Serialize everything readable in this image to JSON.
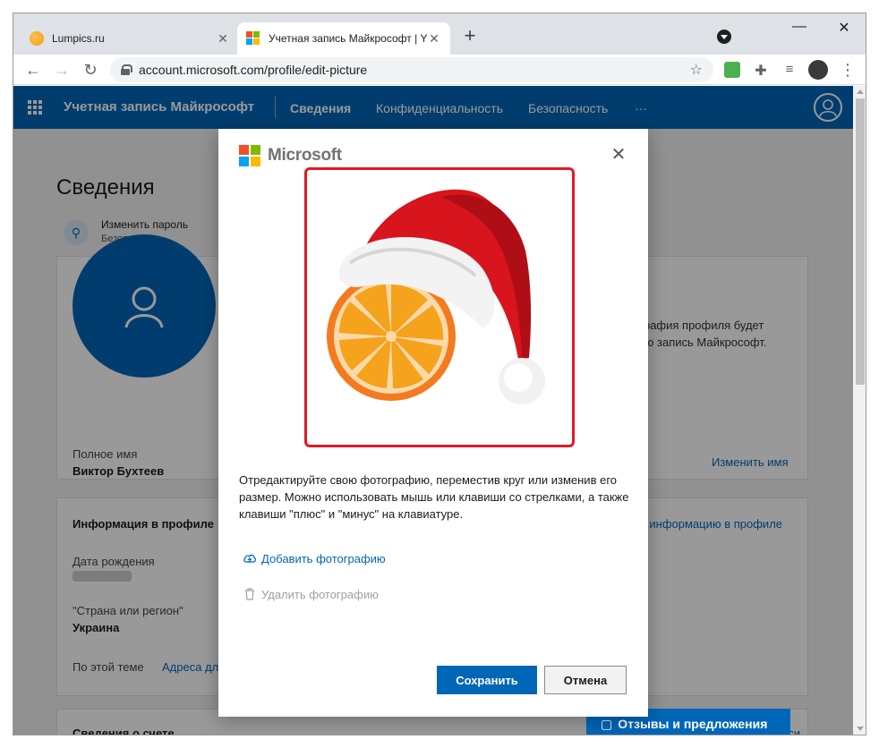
{
  "browser": {
    "tabs": [
      {
        "title": "Lumpics.ru",
        "close": "✕"
      },
      {
        "title": "Учетная запись Майкрософт | Y",
        "close": "✕"
      }
    ],
    "new_tab": "+",
    "window_controls": {
      "minimize": "—",
      "maximize": "☐",
      "close": "✕"
    },
    "nav": {
      "back": "←",
      "forward": "→",
      "reload": "↻"
    },
    "url": "account.microsoft.com/profile/edit-picture",
    "bookmark_icon": "☆",
    "menu": "⋮"
  },
  "header": {
    "title": "Учетная запись Майкрософт",
    "nav": [
      "Сведения",
      "Конфиденциальность",
      "Безопасность",
      "···"
    ],
    "brand_color": "#0067b8"
  },
  "page": {
    "heading": "Сведения",
    "password": {
      "title": "Изменить пароль",
      "subtitle": "Безопасность"
    },
    "profile_card": {
      "full_name_label": "Полное имя",
      "full_name": "Виктор Бухтеев",
      "photo_note_line1": "ография профиля будет",
      "photo_note_line2": "ную запись Майкрософт.",
      "change_name": "Изменить имя"
    },
    "info_card": {
      "title": "Информация в профиле",
      "edit_link": "ь информацию в профиле",
      "birth_label": "Дата рождения",
      "country_label": "\"Страна или регион\"",
      "country": "Украина",
      "related_label": "По этой теме",
      "related_link": "Адреса дл"
    },
    "account_card": {
      "title": "Сведения о счете",
      "link": "иси"
    },
    "feedback": "Отзывы и предложения"
  },
  "modal": {
    "brand": "Microsoft",
    "close": "✕",
    "instructions": "Отредактируйте свою фотографию, переместив круг или изменив его размер. Можно использовать мышь или клавиши со стрелками, а также клавиши \"плюс\" и \"минус\" на клавиатуре.",
    "add_photo": "Добавить фотографию",
    "delete_photo": "Удалить фотографию",
    "save": "Сохранить",
    "cancel": "Отмена",
    "highlight_color": "#e01b24"
  }
}
